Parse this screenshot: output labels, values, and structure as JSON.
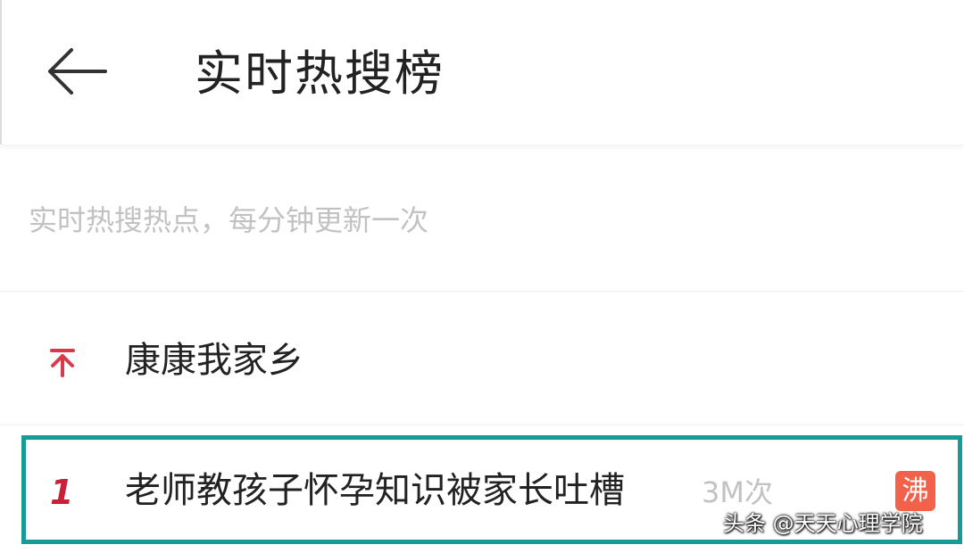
{
  "header": {
    "title": "实时热搜榜",
    "back_icon": "arrow-left-icon"
  },
  "subheader": {
    "text": "实时热搜热点，每分钟更新一次"
  },
  "list": {
    "pinned": {
      "icon": "pin-top-icon",
      "title": "康康我家乡"
    },
    "items": [
      {
        "rank": "1",
        "title": "老师教孩子怀孕知识被家长吐槽",
        "count": "3M次",
        "badge": "沸"
      }
    ]
  },
  "watermark": {
    "text": "头条 @天天心理学院"
  },
  "colors": {
    "accent_red": "#c9203a",
    "badge_orange": "#f2624a",
    "highlight_teal": "#169b96",
    "muted_text": "#c2c2c2"
  }
}
